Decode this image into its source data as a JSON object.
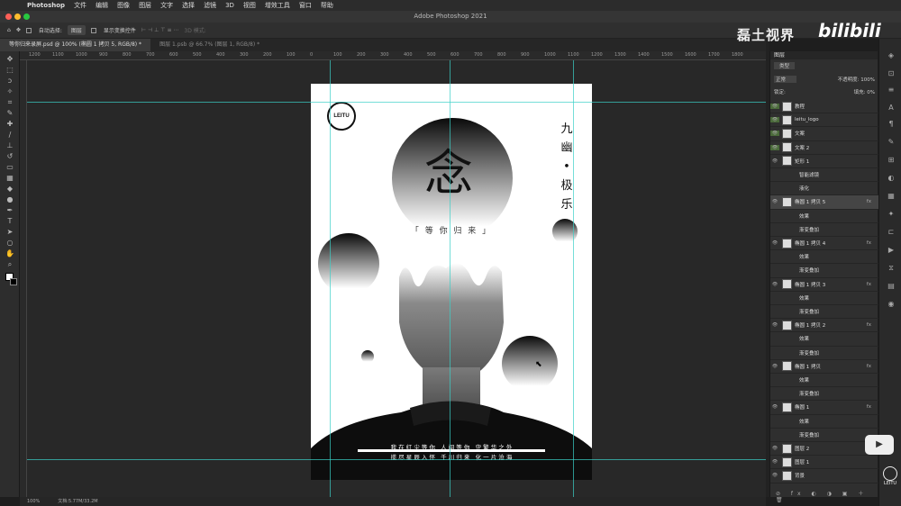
{
  "menu": {
    "app": "Photoshop",
    "items": [
      "文件",
      "编辑",
      "图像",
      "图层",
      "文字",
      "选择",
      "滤镜",
      "3D",
      "视图",
      "增效工具",
      "窗口",
      "帮助"
    ]
  },
  "window_title": "Adobe Photoshop 2021",
  "options": {
    "auto_select": "自动选择:",
    "layer_select": "图层",
    "transform": "显示变换控件",
    "mode3d": "3D 模式:"
  },
  "tabs": [
    {
      "label": "等你归来录屏.psd @ 100% (椭圆 1 拷贝 5, RGB/8) *"
    },
    {
      "label": "图层 1.psb @ 66.7% (图层 1, RGB/8) *"
    }
  ],
  "ruler": [
    "1200",
    "1100",
    "1000",
    "900",
    "800",
    "700",
    "600",
    "500",
    "400",
    "300",
    "200",
    "100",
    "0",
    "100",
    "200",
    "300",
    "400",
    "500",
    "600",
    "700",
    "800",
    "900",
    "1000",
    "1100",
    "1200",
    "1300",
    "1400",
    "1500",
    "1600",
    "1700",
    "1800"
  ],
  "poster": {
    "logo": "LEITU",
    "title_char": "念",
    "vertical_text": [
      "九",
      "幽",
      "•",
      "极",
      "乐"
    ],
    "subtitle": "「 等 你 归 来 」",
    "line1": "我 在 红 尘 等 你   人 间 等 你   守 繁 华 之 外",
    "line2": "揽 尽 星 辰 入 怀   千 川 归 来   化 一 片 沧 海"
  },
  "status": {
    "zoom": "100%",
    "doc": "文档:5.77M/33.2M"
  },
  "layers_panel": {
    "title": "图层",
    "kind": "类型",
    "blend": "正常",
    "opacity_label": "不透明度:",
    "opacity": "100%",
    "lock_label": "锁定:",
    "fill_label": "填充:",
    "fill": "0%",
    "layers": [
      {
        "name": "教程",
        "fx": ""
      },
      {
        "name": "leitu_logo",
        "fx": ""
      },
      {
        "name": "文案",
        "fx": ""
      },
      {
        "name": "文案 2",
        "fx": ""
      },
      {
        "name": "矩形 1",
        "fx": ""
      },
      {
        "name": "智能滤镜",
        "fx": ""
      },
      {
        "name": "液化",
        "fx": ""
      },
      {
        "name": "椭圆 1 拷贝 5",
        "fx": "fx"
      },
      {
        "name": "效果",
        "fx": ""
      },
      {
        "name": "渐变叠加",
        "fx": ""
      },
      {
        "name": "椭圆 1 拷贝 4",
        "fx": "fx"
      },
      {
        "name": "效果",
        "fx": ""
      },
      {
        "name": "渐变叠加",
        "fx": ""
      },
      {
        "name": "椭圆 1 拷贝 3",
        "fx": "fx"
      },
      {
        "name": "效果",
        "fx": ""
      },
      {
        "name": "渐变叠加",
        "fx": ""
      },
      {
        "name": "椭圆 1 拷贝 2",
        "fx": "fx"
      },
      {
        "name": "效果",
        "fx": ""
      },
      {
        "name": "渐变叠加",
        "fx": ""
      },
      {
        "name": "椭圆 1 拷贝",
        "fx": "fx"
      },
      {
        "name": "效果",
        "fx": ""
      },
      {
        "name": "渐变叠加",
        "fx": ""
      },
      {
        "name": "椭圆 1",
        "fx": "fx"
      },
      {
        "name": "效果",
        "fx": ""
      },
      {
        "name": "渐变叠加",
        "fx": ""
      },
      {
        "name": "图层 2",
        "fx": ""
      },
      {
        "name": "图层 1",
        "fx": ""
      },
      {
        "name": "背景",
        "fx": ""
      }
    ]
  },
  "watermark": "磊土视界",
  "bilibili": "bilibili",
  "corner_logo": "LEITU"
}
